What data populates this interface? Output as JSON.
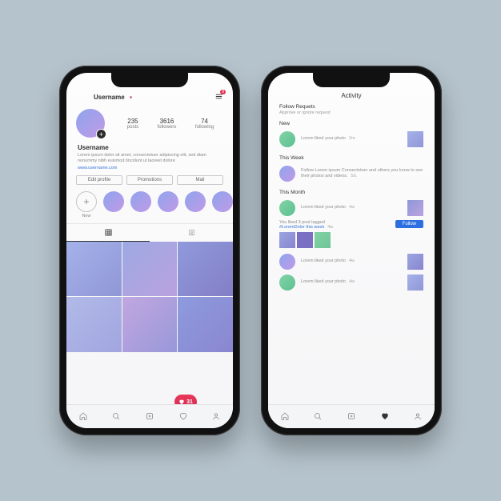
{
  "profile": {
    "header_username": "Username",
    "notification_count": "9",
    "stats": [
      {
        "num": "235",
        "label": "posts"
      },
      {
        "num": "3616",
        "label": "followers"
      },
      {
        "num": "74",
        "label": "following"
      }
    ],
    "bio_name": "Username",
    "bio_text": "Lorem ipsum dolor sit amet, consectetuer adipiscing elit, sed diam nonummy nibh euismod tincidunt ut laoreet dolore",
    "bio_link": "www.username.com",
    "buttons": {
      "edit": "Edit profile",
      "promo": "Promotions",
      "mail": "Mail"
    },
    "highlight_new": "New",
    "like_count": "31"
  },
  "activity": {
    "title": "Activity",
    "follow_requests_heading": "Follow Requets",
    "follow_requests_sub": "Approve or ignore request",
    "sections": {
      "new": "New",
      "this_week": "This Week",
      "this_month": "This Month"
    },
    "row_new": {
      "text": "Lorem liked your photo",
      "time": "2m"
    },
    "row_week": {
      "text": "Follow Lorem ipsum Consectetuer and others you know to see their photos and videos.",
      "time": "5d."
    },
    "row_month_1": {
      "text": "Lorem liked your photo",
      "time": "4w"
    },
    "tagged": {
      "prefix": "You liked 3 post tagged",
      "tag": "#LoremDolor this week",
      "time": "4w"
    },
    "follow_label": "Follow",
    "row_month_2": {
      "text": "Lorem liked your photo",
      "time": "4w"
    },
    "row_month_3": {
      "text": "Lorem liked your photo",
      "time": "4w"
    }
  },
  "colors": {
    "accent": "#e1334e",
    "link": "#3976d8",
    "follow": "#2d6fe0"
  }
}
